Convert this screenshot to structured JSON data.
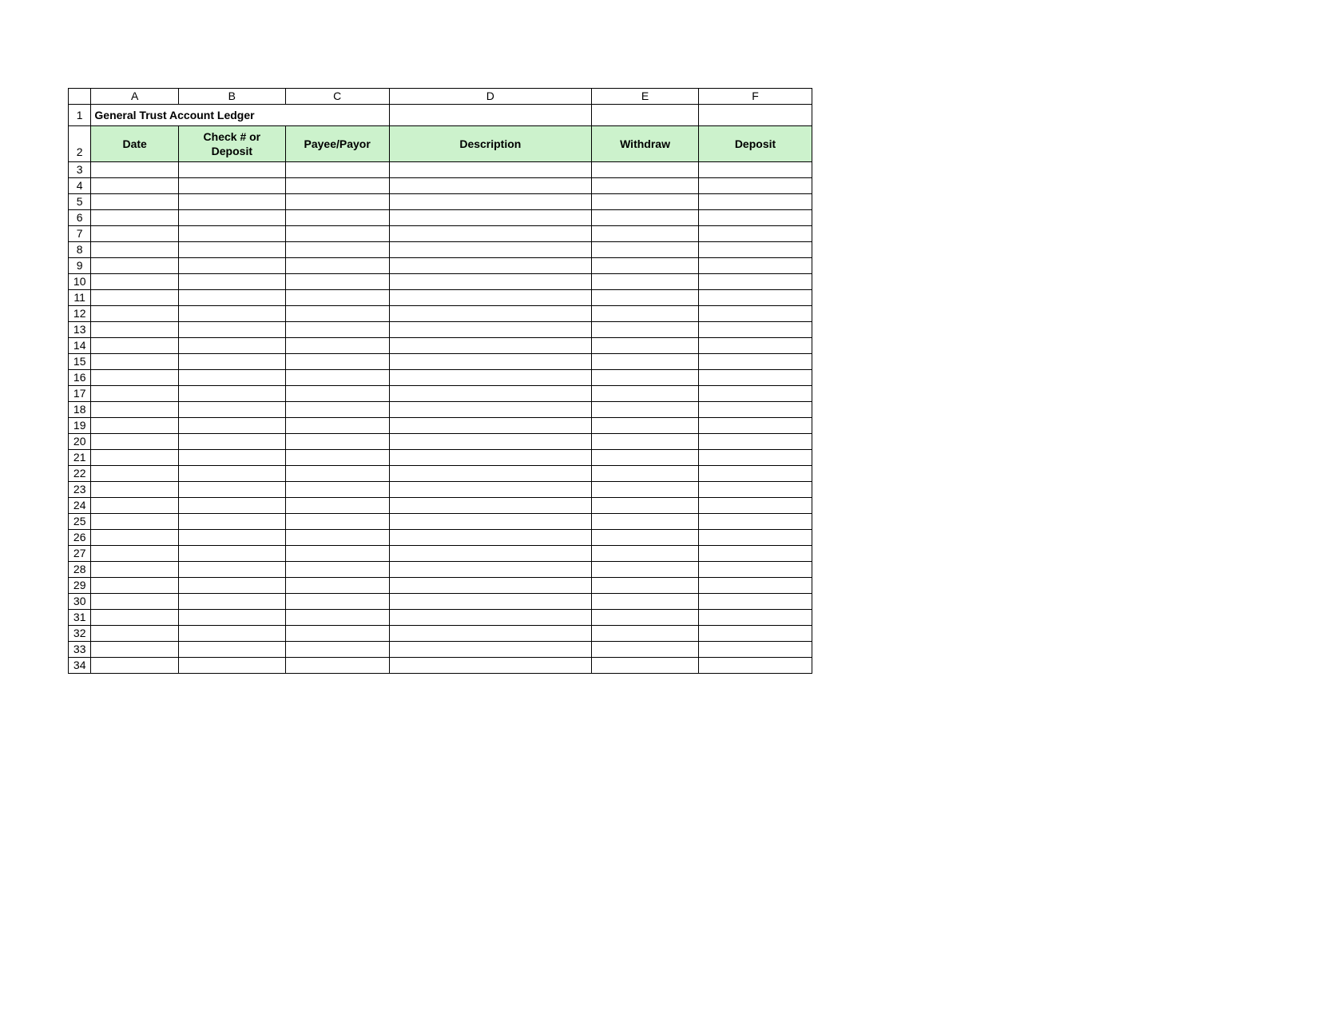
{
  "columns": [
    "A",
    "B",
    "C",
    "D",
    "E",
    "F"
  ],
  "row_numbers": [
    1,
    2,
    3,
    4,
    5,
    6,
    7,
    8,
    9,
    10,
    11,
    12,
    13,
    14,
    15,
    16,
    17,
    18,
    19,
    20,
    21,
    22,
    23,
    24,
    25,
    26,
    27,
    28,
    29,
    30,
    31,
    32,
    33,
    34
  ],
  "title": "General Trust Account Ledger",
  "headers": {
    "A": "Date",
    "B_line1": "Check # or",
    "B_line2": "Deposit",
    "C": "Payee/Payor",
    "D": "Description",
    "E": "Withdraw",
    "F": "Deposit"
  },
  "data_rows": [
    {
      "A": "",
      "B": "",
      "C": "",
      "D": "",
      "E": "",
      "F": ""
    },
    {
      "A": "",
      "B": "",
      "C": "",
      "D": "",
      "E": "",
      "F": ""
    },
    {
      "A": "",
      "B": "",
      "C": "",
      "D": "",
      "E": "",
      "F": ""
    },
    {
      "A": "",
      "B": "",
      "C": "",
      "D": "",
      "E": "",
      "F": ""
    },
    {
      "A": "",
      "B": "",
      "C": "",
      "D": "",
      "E": "",
      "F": ""
    },
    {
      "A": "",
      "B": "",
      "C": "",
      "D": "",
      "E": "",
      "F": ""
    },
    {
      "A": "",
      "B": "",
      "C": "",
      "D": "",
      "E": "",
      "F": ""
    },
    {
      "A": "",
      "B": "",
      "C": "",
      "D": "",
      "E": "",
      "F": ""
    },
    {
      "A": "",
      "B": "",
      "C": "",
      "D": "",
      "E": "",
      "F": ""
    },
    {
      "A": "",
      "B": "",
      "C": "",
      "D": "",
      "E": "",
      "F": ""
    },
    {
      "A": "",
      "B": "",
      "C": "",
      "D": "",
      "E": "",
      "F": ""
    },
    {
      "A": "",
      "B": "",
      "C": "",
      "D": "",
      "E": "",
      "F": ""
    },
    {
      "A": "",
      "B": "",
      "C": "",
      "D": "",
      "E": "",
      "F": ""
    },
    {
      "A": "",
      "B": "",
      "C": "",
      "D": "",
      "E": "",
      "F": ""
    },
    {
      "A": "",
      "B": "",
      "C": "",
      "D": "",
      "E": "",
      "F": ""
    },
    {
      "A": "",
      "B": "",
      "C": "",
      "D": "",
      "E": "",
      "F": ""
    },
    {
      "A": "",
      "B": "",
      "C": "",
      "D": "",
      "E": "",
      "F": ""
    },
    {
      "A": "",
      "B": "",
      "C": "",
      "D": "",
      "E": "",
      "F": ""
    },
    {
      "A": "",
      "B": "",
      "C": "",
      "D": "",
      "E": "",
      "F": ""
    },
    {
      "A": "",
      "B": "",
      "C": "",
      "D": "",
      "E": "",
      "F": ""
    },
    {
      "A": "",
      "B": "",
      "C": "",
      "D": "",
      "E": "",
      "F": ""
    },
    {
      "A": "",
      "B": "",
      "C": "",
      "D": "",
      "E": "",
      "F": ""
    },
    {
      "A": "",
      "B": "",
      "C": "",
      "D": "",
      "E": "",
      "F": ""
    },
    {
      "A": "",
      "B": "",
      "C": "",
      "D": "",
      "E": "",
      "F": ""
    },
    {
      "A": "",
      "B": "",
      "C": "",
      "D": "",
      "E": "",
      "F": ""
    },
    {
      "A": "",
      "B": "",
      "C": "",
      "D": "",
      "E": "",
      "F": ""
    },
    {
      "A": "",
      "B": "",
      "C": "",
      "D": "",
      "E": "",
      "F": ""
    },
    {
      "A": "",
      "B": "",
      "C": "",
      "D": "",
      "E": "",
      "F": ""
    },
    {
      "A": "",
      "B": "",
      "C": "",
      "D": "",
      "E": "",
      "F": ""
    },
    {
      "A": "",
      "B": "",
      "C": "",
      "D": "",
      "E": "",
      "F": ""
    },
    {
      "A": "",
      "B": "",
      "C": "",
      "D": "",
      "E": "",
      "F": ""
    },
    {
      "A": "",
      "B": "",
      "C": "",
      "D": "",
      "E": "",
      "F": ""
    }
  ]
}
